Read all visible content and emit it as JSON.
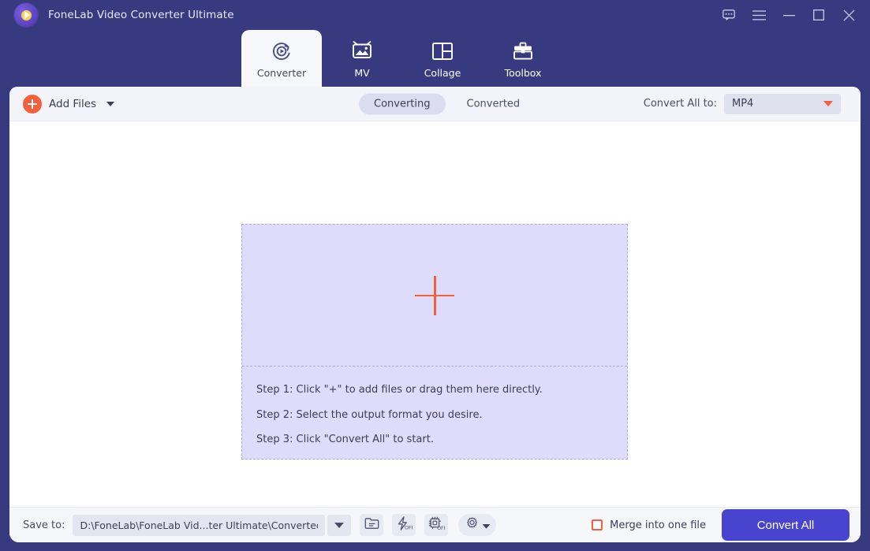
{
  "window": {
    "title": "FoneLab Video Converter Ultimate",
    "logo_icon": "fonelab-play-logo-icon",
    "controls": [
      {
        "name": "feedback-icon",
        "label": "Feedback"
      },
      {
        "name": "menu-icon",
        "label": "Menu"
      },
      {
        "name": "minimize-icon",
        "label": "Minimize"
      },
      {
        "name": "maximize-icon",
        "label": "Maximize"
      },
      {
        "name": "close-icon",
        "label": "Close"
      }
    ]
  },
  "nav": {
    "active_tab": "Converter",
    "tabs": [
      {
        "label": "Converter",
        "icon": "converter-refresh-play-icon",
        "active": true
      },
      {
        "label": "MV",
        "icon": "mv-picture-tv-icon",
        "active": false
      },
      {
        "label": "Collage",
        "icon": "collage-grid-icon",
        "active": false
      },
      {
        "label": "Toolbox",
        "icon": "toolbox-briefcase-icon",
        "active": false
      }
    ]
  },
  "toolbar": {
    "add_files_label": "Add Files",
    "add_files_icon": "plus-circle-icon",
    "add_files_caret_icon": "chevron-down-icon",
    "segments": [
      {
        "label": "Converting",
        "active": true
      },
      {
        "label": "Converted",
        "active": false
      }
    ],
    "convert_all_to_label": "Convert All to:",
    "format_value": "MP4",
    "format_caret_icon": "caret-down-icon"
  },
  "dropzone": {
    "plus_icon": "big-plus-icon",
    "steps": [
      "Step 1: Click \"+\" to add files or drag them here directly.",
      "Step 2: Select the output format you desire.",
      "Step 3: Click \"Convert All\" to start."
    ]
  },
  "bottom": {
    "save_to_label": "Save to:",
    "save_to_path": "D:\\FoneLab\\FoneLab Vid...ter Ultimate\\Converted",
    "path_caret_icon": "caret-down-icon",
    "tools": [
      {
        "name": "open-folder-icon",
        "state": ""
      },
      {
        "name": "hardware-acceleration-icon",
        "state": "OFF"
      },
      {
        "name": "gpu-chip-icon",
        "state": "OFF"
      },
      {
        "name": "settings-gear-icon",
        "state": ""
      }
    ],
    "merge_label": "Merge into one file",
    "merge_checked": false,
    "merge_checkbox_icon": "checkbox-unchecked-icon",
    "convert_all_button": "Convert All"
  },
  "colors": {
    "header_indigo": "#383a80",
    "accent_orange": "#f4603e",
    "accent_blue": "#4944cf",
    "dropzone_lavender": "#dedcfa",
    "toolbar_gray": "#f2f4fa"
  }
}
